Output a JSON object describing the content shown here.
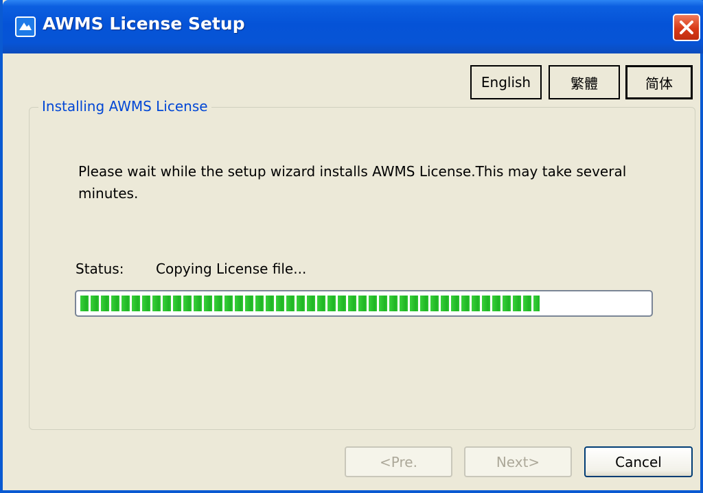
{
  "window": {
    "title": "AWMS License Setup",
    "accent_color": "#0a5ad2",
    "close_icon": "close-icon",
    "app_icon": "awms-app-icon"
  },
  "languages": [
    "English",
    "繁體",
    "简体"
  ],
  "group": {
    "title": "Installing AWMS License"
  },
  "message": "Please wait while the setup wizard installs AWMS License.This may take several minutes.",
  "status": {
    "label": "Status:",
    "value": "Copying License file..."
  },
  "progress": {
    "fraction": 0.81,
    "color": "#2fc832"
  },
  "buttons": {
    "pre": "<Pre.",
    "next": "Next>",
    "cancel": "Cancel"
  }
}
